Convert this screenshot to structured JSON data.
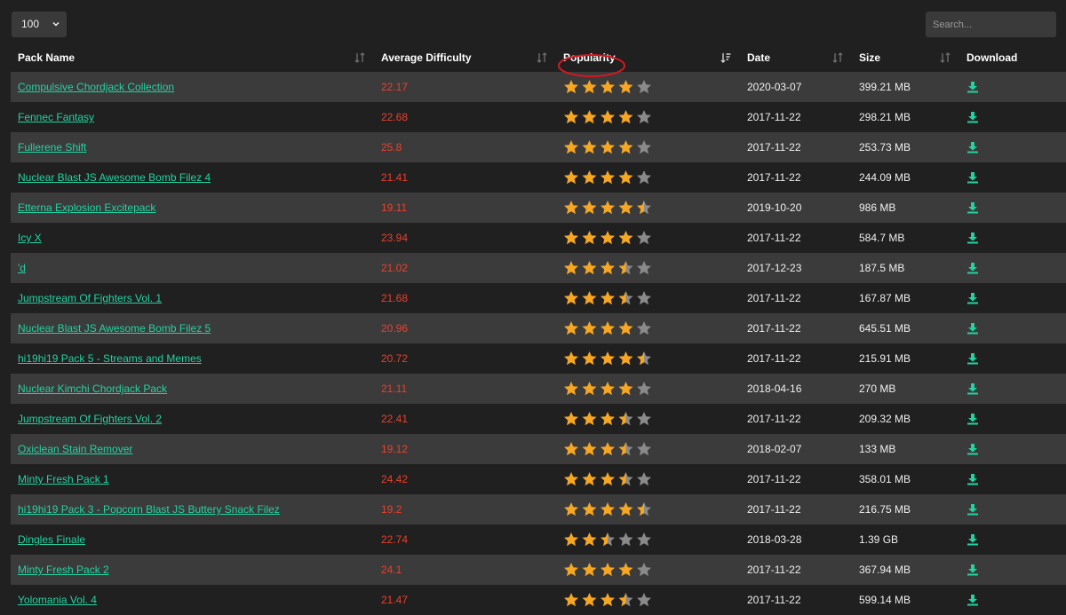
{
  "controls": {
    "page_size": "100",
    "search_placeholder": "Search..."
  },
  "columns": [
    {
      "key": "name",
      "label": "Pack Name"
    },
    {
      "key": "difficulty",
      "label": "Average Difficulty"
    },
    {
      "key": "popularity",
      "label": "Popularity"
    },
    {
      "key": "date",
      "label": "Date"
    },
    {
      "key": "size",
      "label": "Size"
    },
    {
      "key": "download",
      "label": "Download"
    }
  ],
  "sorted_column": "popularity",
  "colors": {
    "link": "#22d3a1",
    "difficulty": "#e8412e",
    "star_filled": "#f5a623",
    "star_empty": "#8a8a8a",
    "highlight_circle": "#d6181f"
  },
  "rows": [
    {
      "name": "Compulsive Chordjack Collection",
      "difficulty": "22.17",
      "rating": 4,
      "date": "2020-03-07",
      "size": "399.21 MB"
    },
    {
      "name": "Fennec Fantasy",
      "difficulty": "22.68",
      "rating": 4,
      "date": "2017-11-22",
      "size": "298.21 MB"
    },
    {
      "name": "Fullerene Shift",
      "difficulty": "25.8",
      "rating": 4,
      "date": "2017-11-22",
      "size": "253.73 MB"
    },
    {
      "name": "Nuclear Blast JS Awesome Bomb Filez 4",
      "difficulty": "21.41",
      "rating": 4,
      "date": "2017-11-22",
      "size": "244.09 MB"
    },
    {
      "name": "Etterna Explosion Excitepack",
      "difficulty": "19.11",
      "rating": 4.5,
      "date": "2019-10-20",
      "size": "986 MB"
    },
    {
      "name": "Icy X",
      "difficulty": "23.94",
      "rating": 4,
      "date": "2017-11-22",
      "size": "584.7 MB"
    },
    {
      "name": "'d",
      "difficulty": "21.02",
      "rating": 3.5,
      "date": "2017-12-23",
      "size": "187.5 MB"
    },
    {
      "name": "Jumpstream Of Fighters Vol. 1",
      "difficulty": "21.68",
      "rating": 3.5,
      "date": "2017-11-22",
      "size": "167.87 MB"
    },
    {
      "name": "Nuclear Blast JS Awesome Bomb Filez 5",
      "difficulty": "20.96",
      "rating": 4,
      "date": "2017-11-22",
      "size": "645.51 MB"
    },
    {
      "name": "hi19hi19 Pack 5 - Streams and Memes",
      "difficulty": "20.72",
      "rating": 4.5,
      "date": "2017-11-22",
      "size": "215.91 MB"
    },
    {
      "name": "Nuclear Kimchi Chordjack Pack",
      "difficulty": "21.11",
      "rating": 4,
      "date": "2018-04-16",
      "size": "270 MB"
    },
    {
      "name": "Jumpstream Of Fighters Vol. 2",
      "difficulty": "22.41",
      "rating": 3.5,
      "date": "2017-11-22",
      "size": "209.32 MB"
    },
    {
      "name": "Oxiclean Stain Remover",
      "difficulty": "19.12",
      "rating": 3.5,
      "date": "2018-02-07",
      "size": "133 MB"
    },
    {
      "name": "Minty Fresh Pack 1",
      "difficulty": "24.42",
      "rating": 3.5,
      "date": "2017-11-22",
      "size": "358.01 MB"
    },
    {
      "name": "hi19hi19 Pack 3 - Popcorn Blast JS Buttery Snack Filez",
      "difficulty": "19.2",
      "rating": 4.5,
      "date": "2017-11-22",
      "size": "216.75 MB"
    },
    {
      "name": "Dingles Finale",
      "difficulty": "22.74",
      "rating": 2.5,
      "date": "2018-03-28",
      "size": "1.39 GB"
    },
    {
      "name": "Minty Fresh Pack 2",
      "difficulty": "24.1",
      "rating": 4,
      "date": "2017-11-22",
      "size": "367.94 MB"
    },
    {
      "name": "Yolomania Vol. 4",
      "difficulty": "21.47",
      "rating": 3.5,
      "date": "2017-11-22",
      "size": "599.14 MB"
    }
  ]
}
